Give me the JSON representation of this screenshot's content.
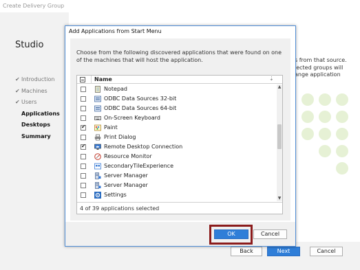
{
  "window": {
    "title": "Create Delivery Group"
  },
  "sidebar": {
    "app_name": "Studio",
    "steps": [
      {
        "label": "Introduction",
        "done": true
      },
      {
        "label": "Machines",
        "done": true
      },
      {
        "label": "Users",
        "done": true
      },
      {
        "label": "Applications",
        "active": true
      },
      {
        "label": "Desktops"
      },
      {
        "label": "Summary"
      }
    ]
  },
  "main": {
    "partial_text_lines": [
      "s from that source.",
      "lected groups will",
      "ange application"
    ]
  },
  "footer": {
    "back_label": "Back",
    "next_label": "Next",
    "cancel_label": "Cancel"
  },
  "dialog": {
    "title": "Add Applications from Start Menu",
    "description": "Choose from the following discovered applications that were found on one of the machines that will host the application.",
    "column_name": "Name",
    "items": [
      {
        "name": "Notepad",
        "checked": false,
        "icon": "notepad-icon"
      },
      {
        "name": "ODBC Data Sources 32-bit",
        "checked": false,
        "icon": "odbc-icon"
      },
      {
        "name": "ODBC Data Sources 64-bit",
        "checked": false,
        "icon": "odbc-icon"
      },
      {
        "name": "On-Screen Keyboard",
        "checked": false,
        "icon": "keyboard-icon"
      },
      {
        "name": "Paint",
        "checked": true,
        "icon": "paint-icon"
      },
      {
        "name": "Print Dialog",
        "checked": false,
        "icon": "printer-icon"
      },
      {
        "name": "Remote Desktop Connection",
        "checked": true,
        "icon": "remote-desktop-icon"
      },
      {
        "name": "Resource Monitor",
        "checked": false,
        "icon": "resource-monitor-icon"
      },
      {
        "name": "SecondaryTileExperience",
        "checked": false,
        "icon": "tile-icon"
      },
      {
        "name": "Server Manager",
        "checked": false,
        "icon": "server-manager-icon"
      },
      {
        "name": "Server Manager",
        "checked": false,
        "icon": "server-manager-icon"
      },
      {
        "name": "Settings",
        "checked": false,
        "icon": "settings-icon"
      }
    ],
    "selection_status": "4 of 39 applications selected",
    "ok_label": "OK",
    "cancel_label": "Cancel"
  },
  "colors": {
    "accent": "#2f7ed8",
    "highlight_box": "#8b1c1c"
  }
}
